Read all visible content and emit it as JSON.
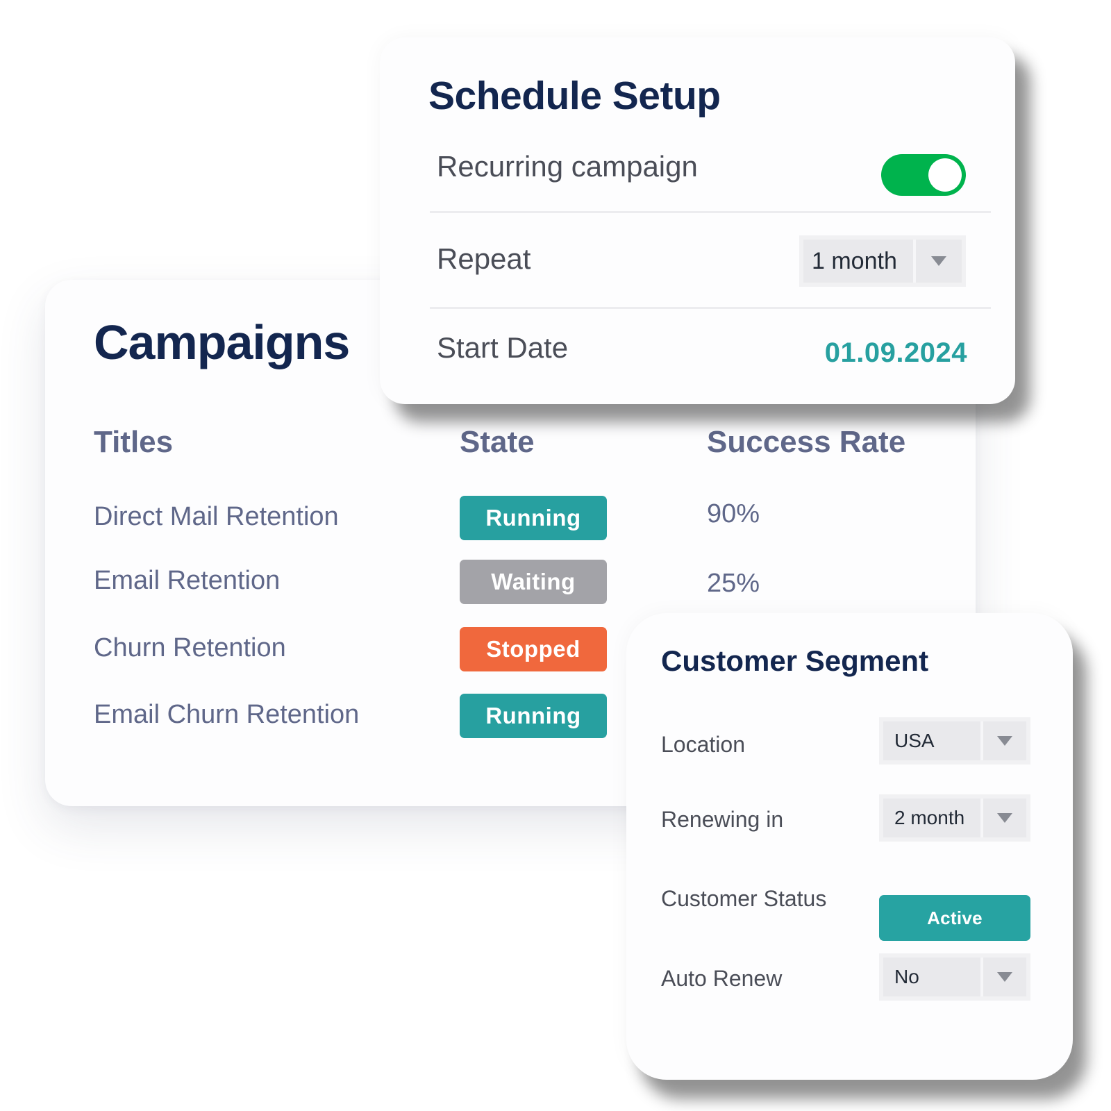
{
  "campaigns": {
    "title": "Campaigns",
    "columns": {
      "titles": "Titles",
      "state": "State",
      "success_rate": "Success Rate"
    },
    "rows": [
      {
        "title": "Direct Mail Retention",
        "state": "Running",
        "state_color": "#27a0a0",
        "success_rate": "90%"
      },
      {
        "title": "Email Retention",
        "state": "Waiting",
        "state_color": "#a3a3a8",
        "success_rate": "25%"
      },
      {
        "title": "Churn Retention",
        "state": "Stopped",
        "state_color": "#f0683d",
        "success_rate": ""
      },
      {
        "title": "Email Churn Retention",
        "state": "Running",
        "state_color": "#27a0a0",
        "success_rate": ""
      }
    ]
  },
  "schedule": {
    "title": "Schedule Setup",
    "recurring_label": "Recurring campaign",
    "recurring_on": true,
    "toggle_color": "#00b34d",
    "repeat_label": "Repeat",
    "repeat_value": "1 month",
    "start_date_label": "Start Date",
    "start_date_value": "01.09.2024",
    "start_date_color": "#27a0a0"
  },
  "segment": {
    "title": "Customer Segment",
    "location_label": "Location",
    "location_value": "USA",
    "renewing_label": "Renewing in",
    "renewing_value": "2 month",
    "status_label": "Customer Status",
    "status_value": "Active",
    "auto_renew_label": "Auto Renew",
    "auto_renew_value": "No"
  },
  "colors": {
    "heading": "#13264f",
    "muted_text": "#5f6789",
    "accent_teal": "#27a3a2"
  },
  "icons": {
    "dropdown": "chevron-down-icon"
  }
}
